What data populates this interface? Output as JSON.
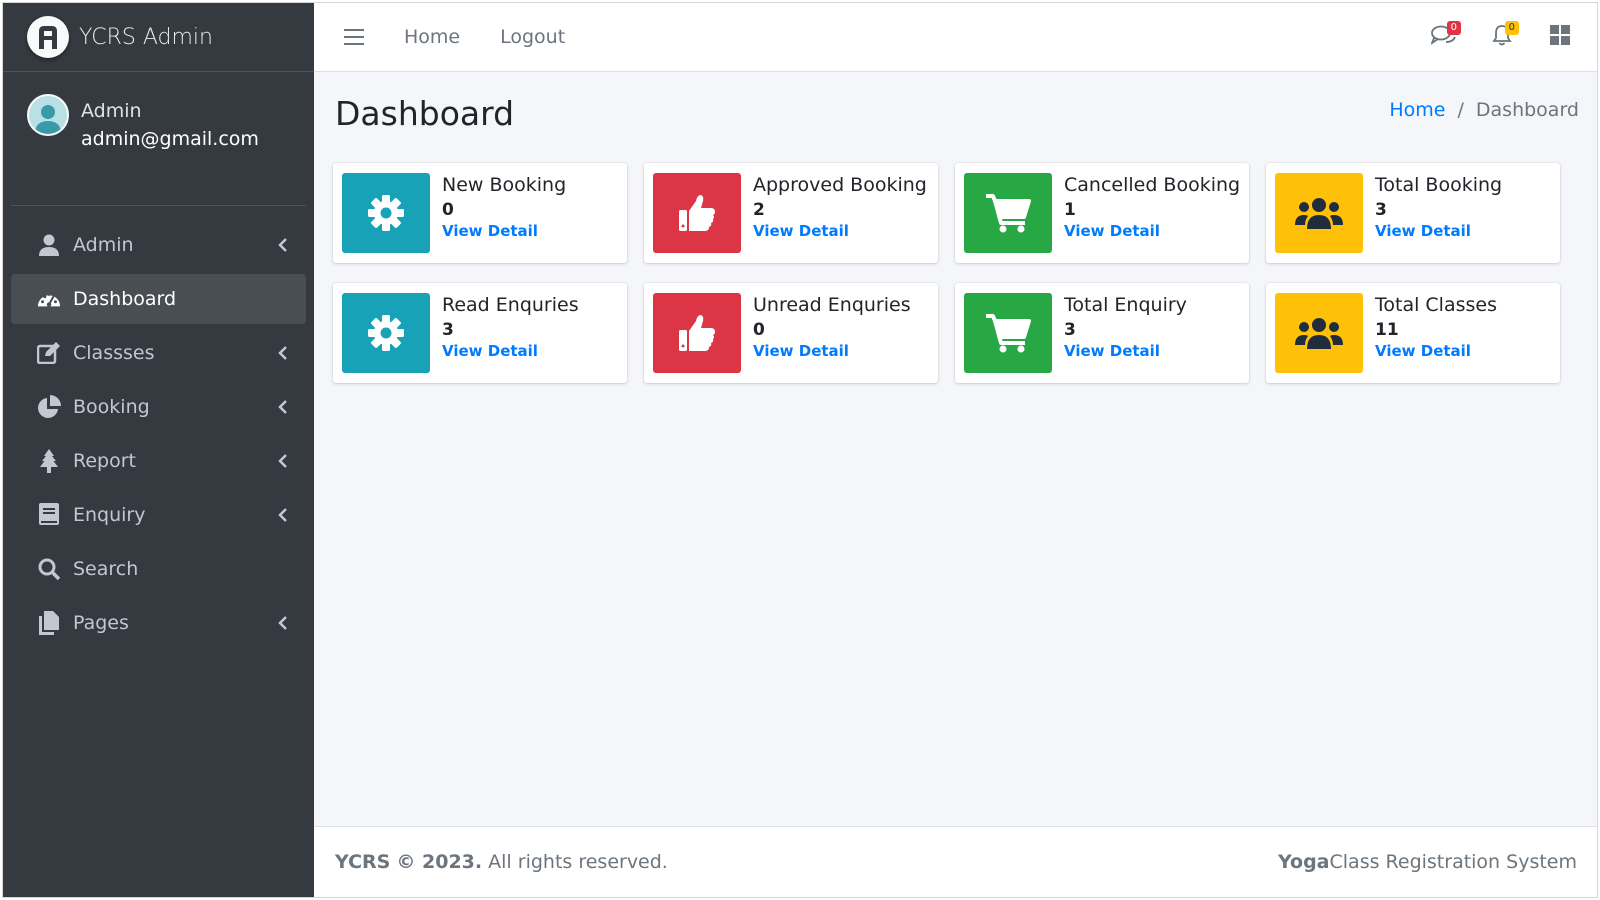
{
  "brand": {
    "title": "YCRS Admin"
  },
  "user": {
    "name": "Admin",
    "email": "admin@gmail.com"
  },
  "sidebar": {
    "items": [
      {
        "label": "Admin",
        "icon": "user-icon",
        "has_submenu": true,
        "active": false
      },
      {
        "label": "Dashboard",
        "icon": "tachometer-icon",
        "has_submenu": false,
        "active": true
      },
      {
        "label": "Classses",
        "icon": "edit-icon",
        "has_submenu": true,
        "active": false
      },
      {
        "label": "Booking",
        "icon": "pie-chart-icon",
        "has_submenu": true,
        "active": false
      },
      {
        "label": "Report",
        "icon": "tree-icon",
        "has_submenu": true,
        "active": false
      },
      {
        "label": "Enquiry",
        "icon": "book-icon",
        "has_submenu": true,
        "active": false
      },
      {
        "label": "Search",
        "icon": "search-icon",
        "has_submenu": false,
        "active": false
      },
      {
        "label": "Pages",
        "icon": "copy-icon",
        "has_submenu": true,
        "active": false
      }
    ]
  },
  "topbar": {
    "links": [
      "Home",
      "Logout"
    ],
    "messages_count": "0",
    "notifications_count": "0"
  },
  "page": {
    "title": "Dashboard"
  },
  "breadcrumb": {
    "home": "Home",
    "separator": "/",
    "current": "Dashboard"
  },
  "stats": [
    {
      "label": "New Booking",
      "value": "0",
      "link": "View Detail",
      "color": "#17a2b8",
      "icon": "cog-icon"
    },
    {
      "label": "Approved Booking",
      "value": "2",
      "link": "View Detail",
      "color": "#dc3545",
      "icon": "thumbs-up-icon"
    },
    {
      "label": "Cancelled Booking",
      "value": "1",
      "link": "View Detail",
      "color": "#28a745",
      "icon": "shopping-cart-icon"
    },
    {
      "label": "Total Booking",
      "value": "3",
      "link": "View Detail",
      "color": "#ffc107",
      "icon": "users-icon"
    },
    {
      "label": "Read Enquries",
      "value": "3",
      "link": "View Detail",
      "color": "#17a2b8",
      "icon": "cog-icon"
    },
    {
      "label": "Unread Enquries",
      "value": "0",
      "link": "View Detail",
      "color": "#dc3545",
      "icon": "thumbs-up-icon"
    },
    {
      "label": "Total Enquiry",
      "value": "3",
      "link": "View Detail",
      "color": "#28a745",
      "icon": "shopping-cart-icon"
    },
    {
      "label": "Total Classes",
      "value": "11",
      "link": "View Detail",
      "color": "#ffc107",
      "icon": "users-icon"
    }
  ],
  "footer": {
    "brand": "YCRS",
    "copyright": "© 2023.",
    "rights": "All rights reserved.",
    "right_bold": "Yoga",
    "right_rest": "Class Registration System"
  }
}
